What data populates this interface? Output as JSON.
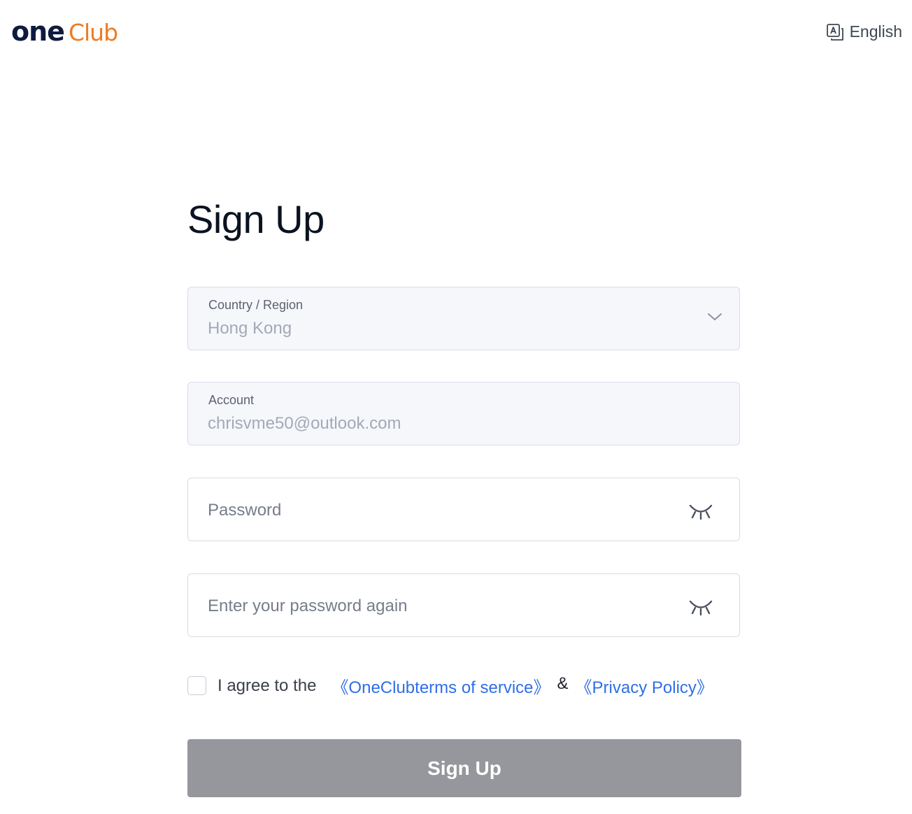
{
  "header": {
    "logo_one": "one",
    "logo_club": "Club",
    "language": "English",
    "language_icon": "translate-icon"
  },
  "form": {
    "title": "Sign Up",
    "country": {
      "label": "Country / Region",
      "value": "Hong Kong",
      "icon": "chevron-down-icon"
    },
    "account": {
      "label": "Account",
      "value": "chrisvme50@outlook.com"
    },
    "password": {
      "placeholder": "Password",
      "icon": "eye-closed-icon"
    },
    "confirm_password": {
      "placeholder": "Enter your password again",
      "icon": "eye-closed-icon"
    },
    "agreement": {
      "prefix": "I agree to the",
      "terms_link": "《OneClubterms of service》",
      "ampersand": "&",
      "privacy_link": "《Privacy Policy》",
      "checked": false
    },
    "submit_label": "Sign Up"
  },
  "colors": {
    "brand_dark": "#0f1b3d",
    "brand_orange": "#ee7b22",
    "link_blue": "#2f6ee8",
    "button_disabled": "#96979c"
  }
}
